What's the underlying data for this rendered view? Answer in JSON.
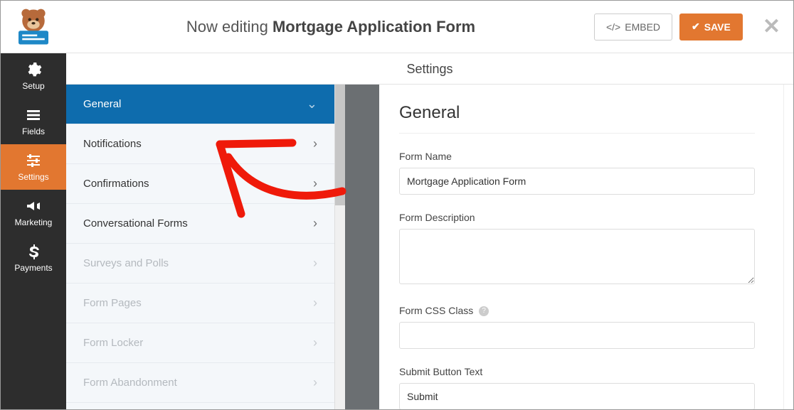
{
  "header": {
    "now_editing": "Now editing",
    "form_title": "Mortgage Application Form",
    "embed_label": "EMBED",
    "save_label": "SAVE"
  },
  "rail": {
    "items": [
      {
        "label": "Setup",
        "icon": "gear"
      },
      {
        "label": "Fields",
        "icon": "list"
      },
      {
        "label": "Settings",
        "icon": "sliders",
        "active": true
      },
      {
        "label": "Marketing",
        "icon": "bullhorn"
      },
      {
        "label": "Payments",
        "icon": "dollar"
      }
    ]
  },
  "settings": {
    "title": "Settings",
    "menu": [
      {
        "label": "General",
        "active": true,
        "disabled": false
      },
      {
        "label": "Notifications",
        "active": false,
        "disabled": false
      },
      {
        "label": "Confirmations",
        "active": false,
        "disabled": false
      },
      {
        "label": "Conversational Forms",
        "active": false,
        "disabled": false
      },
      {
        "label": "Surveys and Polls",
        "active": false,
        "disabled": true
      },
      {
        "label": "Form Pages",
        "active": false,
        "disabled": true
      },
      {
        "label": "Form Locker",
        "active": false,
        "disabled": true
      },
      {
        "label": "Form Abandonment",
        "active": false,
        "disabled": true
      }
    ]
  },
  "panel": {
    "heading": "General",
    "form_name_label": "Form Name",
    "form_name_value": "Mortgage Application Form",
    "form_desc_label": "Form Description",
    "form_desc_value": "",
    "form_css_label": "Form CSS Class",
    "form_css_value": "",
    "submit_text_label": "Submit Button Text",
    "submit_text_value": "Submit"
  },
  "annotation": {
    "color": "#ef1a0a"
  }
}
